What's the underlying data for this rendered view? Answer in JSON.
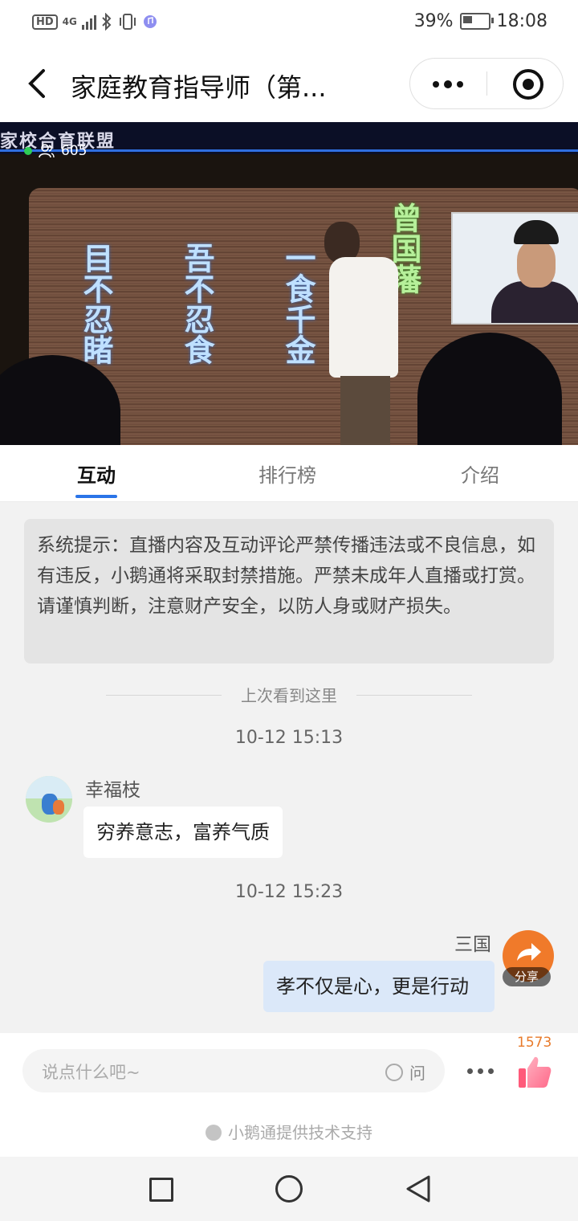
{
  "status_bar": {
    "network": "HD",
    "network_type": "4G",
    "battery": "39%",
    "battery_level": 0.39,
    "time": "18:08"
  },
  "header": {
    "title": "家庭教育指导师（第...",
    "back_icon": "chevron-left-icon",
    "more_icon": "more-icon",
    "close_icon": "target-icon"
  },
  "video": {
    "brand_text": "家校合育联盟",
    "viewers": "605",
    "screen_text_cols": [
      "目不忍睹",
      "吾不忍食",
      "一食千金",
      "曾国藩"
    ]
  },
  "tabs": [
    {
      "label": "互动",
      "active": true
    },
    {
      "label": "排行榜",
      "active": false
    },
    {
      "label": "介绍",
      "active": false
    }
  ],
  "notice": {
    "text": "系统提示：直播内容及互动评论严禁传播违法或不良信息，如有违反，小鹅通将采取封禁措施。严禁未成年人直播或打赏。请谨慎判断，注意财产安全，以防人身或财产损失。"
  },
  "divider": {
    "label": "上次看到这里"
  },
  "messages": [
    {
      "time": "10-12 15:13",
      "user": "幸福枝",
      "text": "穷养意志，富养气质",
      "side": "left"
    },
    {
      "time": "10-12 15:23",
      "user": "三国",
      "text": "孝不仅是心，更是行动",
      "side": "right"
    }
  ],
  "share": {
    "label": "分享",
    "icon": "share-arrow-icon"
  },
  "input": {
    "placeholder": "说点什么吧~",
    "ask_label": "问",
    "likes": "1573",
    "powered_by": "小鹅通提供技术支持"
  },
  "colors": {
    "accent": "#2a74e8",
    "share": "#f07a2a",
    "likes": "#e87a2a",
    "bubble_right": "#dbe8f9"
  }
}
